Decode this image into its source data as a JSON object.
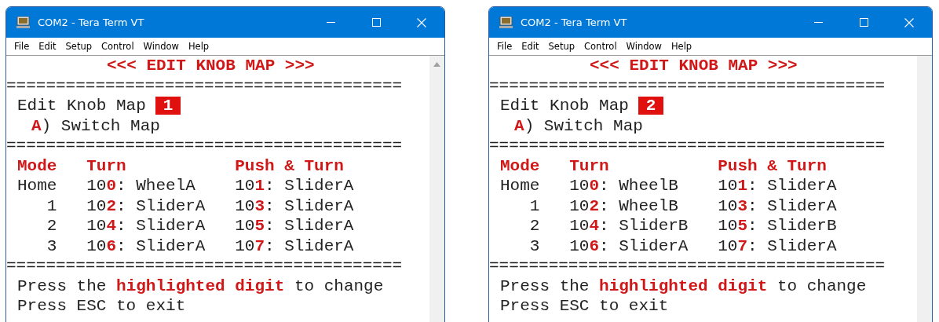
{
  "windows": [
    {
      "title": "COM2 - Tera Term VT",
      "menu": [
        "File",
        "Edit",
        "Setup",
        "Control",
        "Window",
        "Help"
      ],
      "scroll_arrow_visible": true,
      "terminal": {
        "heading": "<<< EDIT KNOB MAP >>>",
        "separators": [
          "========================================",
          "========================================",
          "========================================"
        ],
        "map_label": "Edit Knob Map",
        "map_number": "1",
        "option": "**A**) Switch Map",
        "columns": [
          "Mode",
          "Turn",
          "Push & Turn"
        ],
        "rows": [
          {
            "mode": "Home",
            "turn": "10**0**: WheelA",
            "push_turn": "10**1**: SliderA"
          },
          {
            "mode": "1",
            "turn": "10**2**: SliderA",
            "push_turn": "10**3**: SliderA"
          },
          {
            "mode": "2",
            "turn": "10**4**: SliderA",
            "push_turn": "10**5**: SliderA"
          },
          {
            "mode": "3",
            "turn": "10**6**: SliderA",
            "push_turn": "10**7**: SliderA"
          }
        ],
        "footer": [
          "Press the **highlighted digit** to change",
          "Press ESC to exit"
        ]
      }
    },
    {
      "title": "COM2 - Tera Term VT",
      "menu": [
        "File",
        "Edit",
        "Setup",
        "Control",
        "Window",
        "Help"
      ],
      "scroll_arrow_visible": false,
      "terminal": {
        "heading": "<<< EDIT KNOB MAP >>>",
        "separators": [
          "========================================",
          "========================================",
          "========================================"
        ],
        "map_label": "Edit Knob Map",
        "map_number": "2",
        "option": "**A**) Switch Map",
        "columns": [
          "Mode",
          "Turn",
          "Push & Turn"
        ],
        "rows": [
          {
            "mode": "Home",
            "turn": "10**0**: WheelB",
            "push_turn": "10**1**: SliderA"
          },
          {
            "mode": "1",
            "turn": "10**2**: WheelB",
            "push_turn": "10**3**: SliderA"
          },
          {
            "mode": "2",
            "turn": "10**4**: SliderB",
            "push_turn": "10**5**: SliderB"
          },
          {
            "mode": "3",
            "turn": "10**6**: SliderA",
            "push_turn": "10**7**: SliderA"
          }
        ],
        "footer": [
          "Press the **highlighted digit** to change",
          "Press ESC to exit"
        ]
      }
    }
  ]
}
